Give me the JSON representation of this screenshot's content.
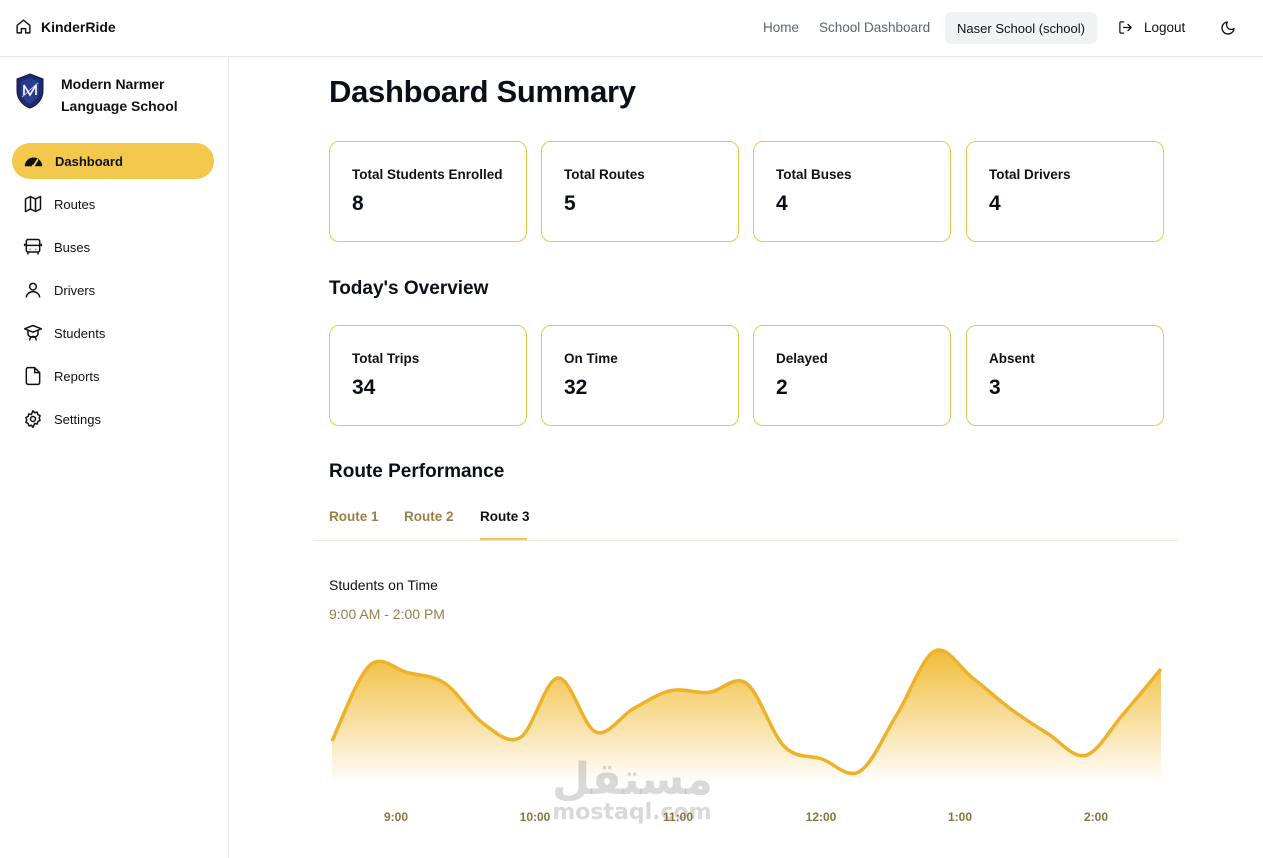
{
  "header": {
    "brand": "KinderRide",
    "nav": {
      "home": "Home",
      "school_dashboard": "School Dashboard"
    },
    "school_pill": "Naser School (school)",
    "logout": "Logout"
  },
  "sidebar": {
    "school_name": "Modern Narmer Language School",
    "items": [
      {
        "label": "Dashboard",
        "icon": "gauge-icon",
        "active": true
      },
      {
        "label": "Routes",
        "icon": "map-icon"
      },
      {
        "label": "Buses",
        "icon": "bus-icon"
      },
      {
        "label": "Drivers",
        "icon": "user-icon"
      },
      {
        "label": "Students",
        "icon": "graduation-icon"
      },
      {
        "label": "Reports",
        "icon": "file-icon"
      },
      {
        "label": "Settings",
        "icon": "gear-icon"
      }
    ]
  },
  "main": {
    "title": "Dashboard Summary",
    "summary_cards": [
      {
        "label": "Total Students Enrolled",
        "value": "8"
      },
      {
        "label": "Total Routes",
        "value": "5"
      },
      {
        "label": "Total Buses",
        "value": "4"
      },
      {
        "label": "Total Drivers",
        "value": "4"
      }
    ],
    "overview_title": "Today's Overview",
    "overview_cards": [
      {
        "label": "Total Trips",
        "value": "34"
      },
      {
        "label": "On Time",
        "value": "32"
      },
      {
        "label": "Delayed",
        "value": "2"
      },
      {
        "label": "Absent",
        "value": "3"
      }
    ],
    "performance_title": "Route Performance",
    "tabs": [
      {
        "label": "Route 1"
      },
      {
        "label": "Route 2"
      },
      {
        "label": "Route 3",
        "active": true
      }
    ],
    "chart_title": "Students on Time",
    "chart_subtitle": "9:00 AM - 2:00 PM"
  },
  "watermark": {
    "arabic": "مستقل",
    "latin": "mostaql.com"
  },
  "colors": {
    "accent": "#f2c94c",
    "card_border": "#f0c64a",
    "muted_gold": "#9a7f4a"
  },
  "chart_data": {
    "type": "area",
    "title": "Students on Time",
    "subtitle": "9:00 AM - 2:00 PM",
    "x_tick_labels": [
      "9:00",
      "10:00",
      "11:00",
      "12:00",
      "1:00",
      "2:00"
    ],
    "x": [
      "8:45",
      "9:00",
      "9:15",
      "9:30",
      "9:45",
      "10:00",
      "10:15",
      "10:30",
      "10:45",
      "11:00",
      "11:15",
      "11:30",
      "11:45",
      "12:00",
      "12:15",
      "12:30",
      "12:45",
      "1:00",
      "1:15",
      "1:30",
      "1:45",
      "2:00",
      "2:15"
    ],
    "values": [
      20,
      62,
      58,
      52,
      30,
      22,
      55,
      25,
      38,
      48,
      47,
      52,
      17,
      10,
      3,
      35,
      70,
      55,
      38,
      24,
      12,
      35,
      60
    ],
    "ylim": [
      0,
      75
    ],
    "grid": false,
    "legend": "none"
  }
}
